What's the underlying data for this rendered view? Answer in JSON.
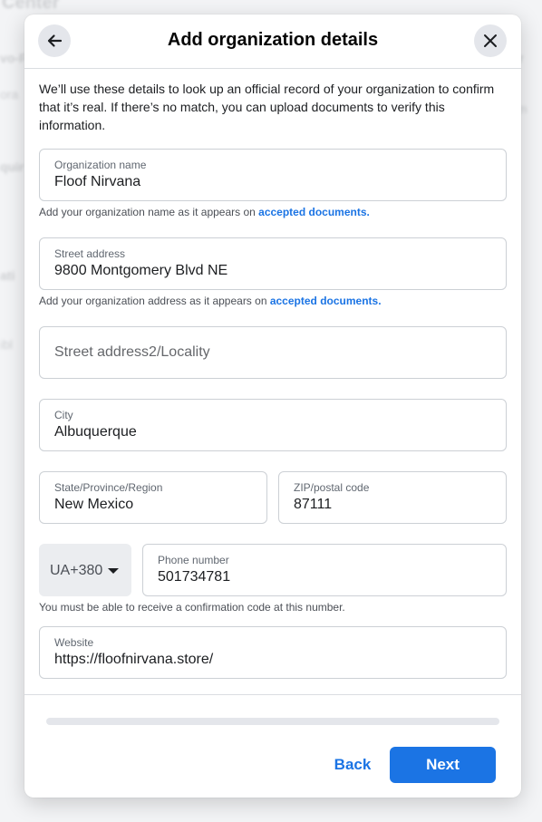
{
  "background": {
    "title": "Center",
    "line1": "vo-F",
    "line2": "ora",
    "line3": "quir",
    "line4": "ati",
    "line5": "ibl",
    "right1": "ner",
    "right2": "m"
  },
  "modal": {
    "title": "Add organization details",
    "back_icon": "arrow-left-icon",
    "close_icon": "close-icon",
    "intro": "We’ll use these details to look up an official record of your organization to confirm that it’s real. If there’s no match, you can upload documents to verify this information."
  },
  "form": {
    "org_name": {
      "label": "Organization name",
      "value": "Floof Nirvana"
    },
    "org_helper": {
      "text": "Add your organization name as it appears on ",
      "link": "accepted documents."
    },
    "street": {
      "label": "Street address",
      "value": "9800 Montgomery Blvd NE"
    },
    "street_helper": {
      "text": "Add your organization address as it appears on ",
      "link": "accepted documents."
    },
    "street2": {
      "placeholder": "Street address2/Locality"
    },
    "city": {
      "label": "City",
      "value": "Albuquerque"
    },
    "state": {
      "label": "State/Province/Region",
      "value": "New Mexico"
    },
    "zip": {
      "label": "ZIP/postal code",
      "value": "87111"
    },
    "country_code": "UA+380",
    "phone": {
      "label": "Phone number",
      "value": "501734781"
    },
    "phone_helper": "You must be able to receive a confirmation code at this number.",
    "website": {
      "label": "Website",
      "value": "https://floofnirvana.store/"
    }
  },
  "footer": {
    "back_label": "Back",
    "next_label": "Next"
  },
  "colors": {
    "accent": "#1b74e4",
    "border": "#ccd0d5"
  }
}
